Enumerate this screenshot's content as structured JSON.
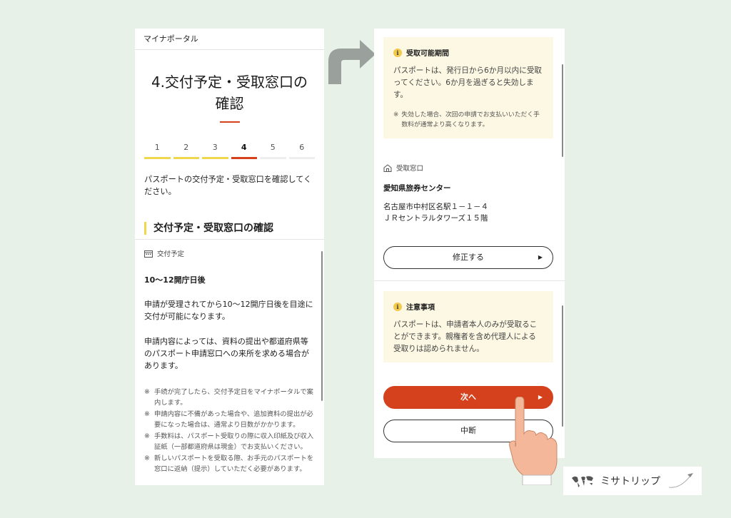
{
  "left": {
    "header": "マイナポータル",
    "title_line1": "4.交付予定・受取窓口の",
    "title_line2": "確認",
    "steps": [
      "1",
      "2",
      "3",
      "4",
      "5",
      "6"
    ],
    "intro": "パスポートの交付予定・受取窓口を確認してください。",
    "section_heading": "交付予定・受取窓口の確認",
    "schedule_label": "交付予定",
    "schedule_value": "10〜12開庁日後",
    "para1": "申請が受理されてから10〜12開庁日後を目途に交付が可能になります。",
    "para2": "申請内容によっては、資料の提出や都道府県等のパスポート申請窓口への来所を求める場合があります。",
    "note_mark": "※",
    "notes": [
      "手続が完了したら、交付予定日をマイナポータルで案内します。",
      "申請内容に不備があった場合や、追加資料の提出が必要になった場合は、通常より日数がかかります。",
      "手数料は、パスポート受取りの際に収入印紙及び収入証紙（一部都道府県は現金）でお支払いください。",
      "新しいパスポートを受取る際、お手元のパスポートを窓口に返納（提示）していただく必要があります。"
    ]
  },
  "right": {
    "period_box": {
      "title": "受取可能期間",
      "body": "パスポートは、発行日から6か月以内に受取ってください。6か月を過ぎると失効します。",
      "note": "失効した場合、次回の申請でお支払いいただく手数料が通常より高くなります。"
    },
    "window_label": "受取窓口",
    "center_name": "愛知県旅券センター",
    "address_line1": "名古屋市中村区名駅１－１－４",
    "address_line2": "ＪＲセントラルタワーズ１５階",
    "edit_button": "修正する",
    "caution_box": {
      "title": "注意事項",
      "body": "パスポートは、申請者本人のみが受取ることができます。親権者を含め代理人による受取りは認められません。"
    },
    "next_button": "次へ",
    "suspend_button": "中断"
  },
  "brand": {
    "name": "ミサトリップ"
  },
  "colors": {
    "background": "#e8f1e7",
    "accent": "#d4411c",
    "highlight": "#f0d84e",
    "info_bg": "#fdf8e3"
  }
}
